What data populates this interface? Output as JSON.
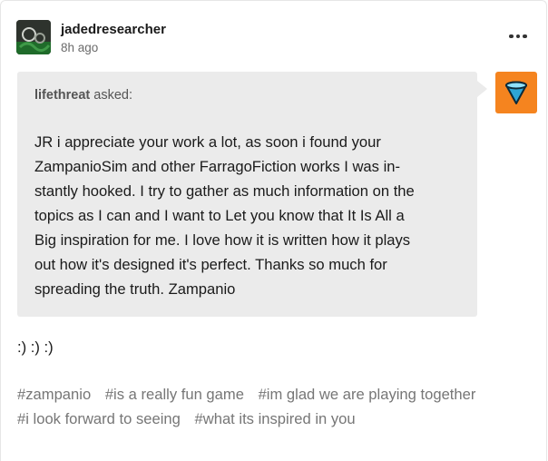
{
  "post": {
    "author": "jadedresearcher",
    "timestamp": "8h ago",
    "more_icon": "more-horizontal-icon"
  },
  "ask": {
    "asker": "lifethreat",
    "asked_label": "asked:",
    "question_lines": [
      "JR i appreciate your work a lot, as soon i found your",
      "ZampanioSim and other FarragoFiction works I was in-",
      "stantly hooked. I try to gather as much information on the",
      "topics as I can and I want to Let you know that It Is All a",
      "Big inspiration for me. I love how it is written how it plays",
      "out how it's designed it's perfect. Thanks so much for",
      "spreading the truth. Zampanio"
    ],
    "asker_avatar_color": "#f5841f"
  },
  "answer": ":) :) :)",
  "tags": [
    "#zampanio",
    "#is a really fun game",
    "#im glad we are playing together",
    "#i look forward to seeing",
    "#what its inspired in you"
  ]
}
